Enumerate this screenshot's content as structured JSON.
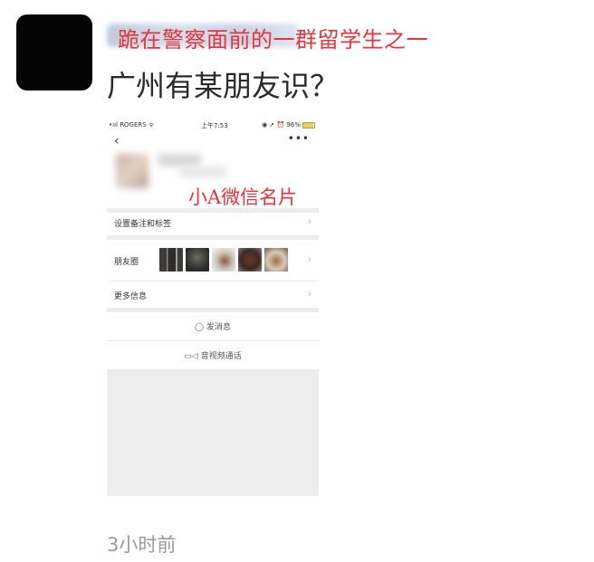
{
  "post": {
    "red_caption": "跪在警察面前的一群留学生之一",
    "text": "广州有某朋友识？",
    "timestamp": "3小时前"
  },
  "screenshot": {
    "status": {
      "carrier": "•ııl ROGERS ᯤ",
      "time": "上午7:53",
      "right": "◉ ➚ ⏰ 96%"
    },
    "nav": {
      "back": "‹",
      "more": "•••"
    },
    "caption": "小A微信名片",
    "rows": [
      {
        "label": "设置备注和标签",
        "chevron": "›"
      },
      {
        "label": "朋友圈",
        "chevron": "›"
      },
      {
        "label": "更多信息",
        "chevron": "›"
      }
    ],
    "actions": {
      "message_icon": "◯",
      "message": "发消息",
      "video_icon": "▭◁",
      "video": "音视频通话"
    },
    "thumb_colors": [
      "#4b4a49",
      "#2c2e2a",
      "#6b4a3c",
      "#5a3a2e",
      "#7a5a4a"
    ]
  }
}
